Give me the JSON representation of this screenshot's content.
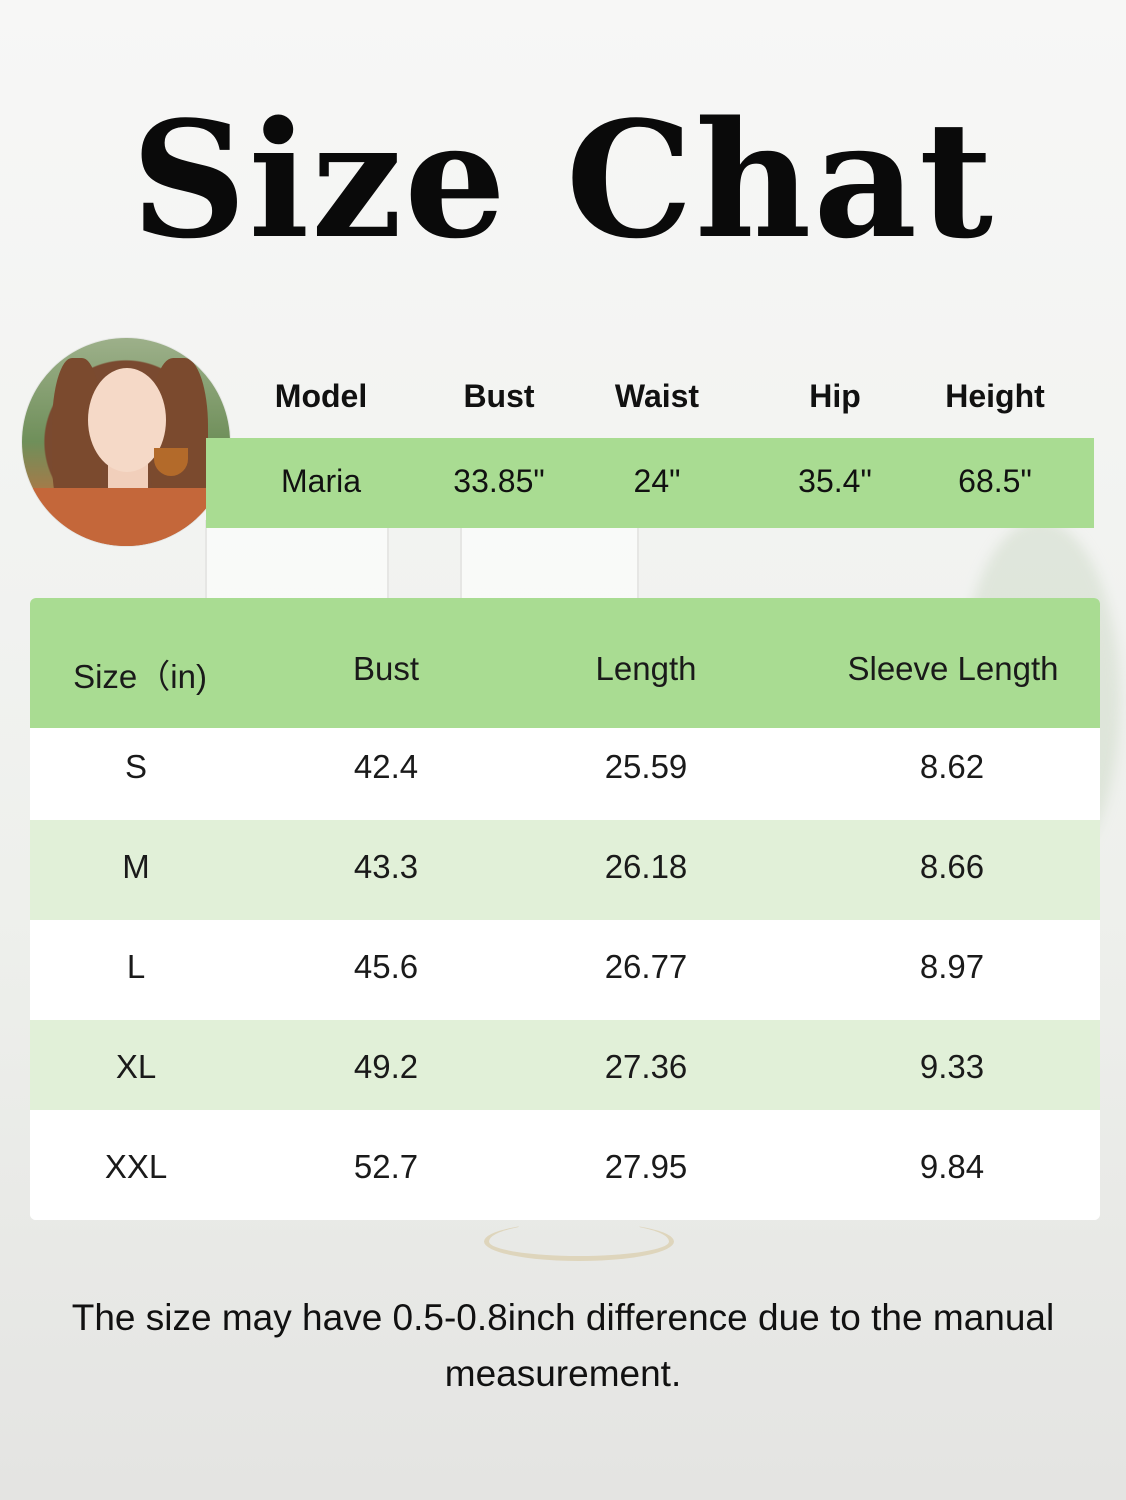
{
  "title": "Size Chat",
  "model": {
    "headers": [
      "Model",
      "Bust",
      "Waist",
      "Hip",
      "Height"
    ],
    "values": [
      "Maria",
      "33.85\"",
      "24\"",
      "35.4\"",
      "68.5\""
    ]
  },
  "size_table": {
    "headers": [
      "Size（in)",
      "Bust",
      "Length",
      "Sleeve Length"
    ],
    "rows": [
      [
        "S",
        "42.4",
        "25.59",
        "8.62"
      ],
      [
        "M",
        "43.3",
        "26.18",
        "8.66"
      ],
      [
        "L",
        "45.6",
        "26.77",
        "8.97"
      ],
      [
        "XL",
        "49.2",
        "27.36",
        "9.33"
      ],
      [
        "XXL",
        "52.7",
        "27.95",
        "9.84"
      ]
    ]
  },
  "note": "The size may have 0.5-0.8inch difference due to the manual measurement.",
  "colors": {
    "header_green": "#a9dc92",
    "row_green": "#e1f0d8",
    "white": "#ffffff"
  }
}
